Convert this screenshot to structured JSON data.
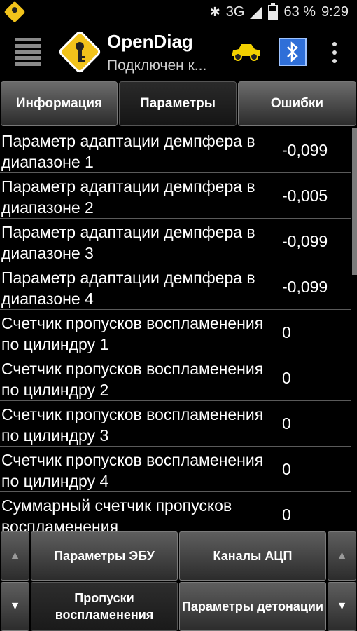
{
  "status_bar": {
    "network": "3G",
    "battery": "63 %",
    "time": "9:29",
    "bluetooth_icon": "bluetooth-icon",
    "signal_icon": "signal-icon",
    "battery_icon": "battery-icon",
    "battery_level": 0.63
  },
  "action_bar": {
    "title": "OpenDiag",
    "subtitle": "Подключен к...",
    "menu_icon": "menu-icon",
    "logo_icon": "opendiag-logo",
    "car_icon": "car-icon",
    "bluetooth_button_icon": "bluetooth-icon",
    "overflow_icon": "overflow-menu-icon",
    "car_color": "#f2d000",
    "bluetooth_color": "#2f6fd8"
  },
  "tabs": [
    {
      "label": "Информация",
      "active": false
    },
    {
      "label": "Параметры",
      "active": true
    },
    {
      "label": "Ошибки",
      "active": false
    }
  ],
  "parameters": [
    {
      "name": "Параметр адаптации демпфера в диапазоне 1",
      "value": "-0,099"
    },
    {
      "name": "Параметр адаптации демпфера в диапазоне 2",
      "value": "-0,005"
    },
    {
      "name": "Параметр адаптации демпфера в диапазоне 3",
      "value": "-0,099"
    },
    {
      "name": "Параметр адаптации демпфера в диапазоне 4",
      "value": "-0,099"
    },
    {
      "name": "Счетчик пропусков воспламенения по цилиндру 1",
      "value": "0"
    },
    {
      "name": "Счетчик пропусков воспламенения по цилиндру 2",
      "value": "0"
    },
    {
      "name": "Счетчик пропусков воспламенения по цилиндру 3",
      "value": "0"
    },
    {
      "name": "Счетчик пропусков воспламенения по цилиндру 4",
      "value": "0"
    },
    {
      "name": "Суммарный счетчик пропусков воспламенения",
      "value": "0"
    }
  ],
  "bottom_nav": {
    "up_arrow": "▲",
    "down_arrow": "▼",
    "buttons": [
      {
        "label": "Параметры ЭБУ"
      },
      {
        "label": "Каналы АЦП"
      },
      {
        "label": "Пропуски воспламенения"
      },
      {
        "label": "Параметры детонации"
      }
    ]
  }
}
